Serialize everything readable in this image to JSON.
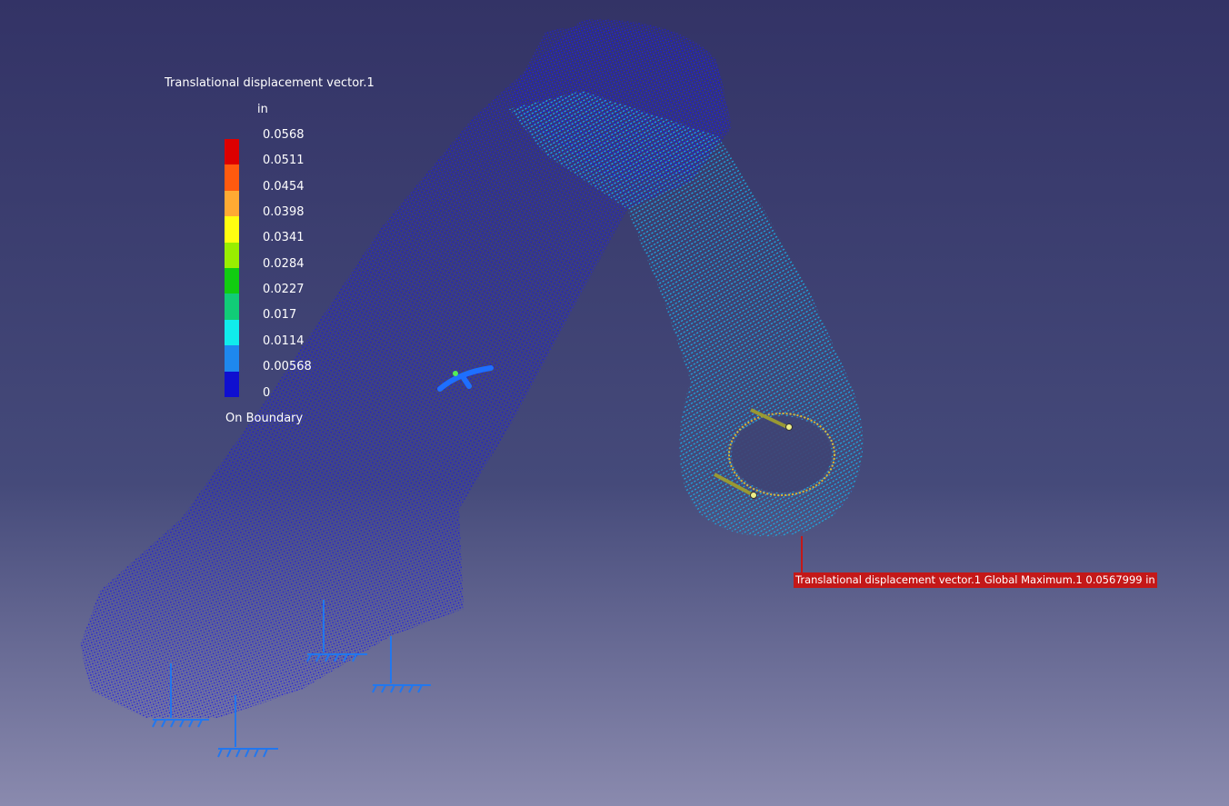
{
  "background": {
    "top_color": "#333366",
    "mid_color": "#454a7a",
    "bottom_color": "#8a8aae"
  },
  "legend": {
    "title": "Translational displacement vector.1",
    "unit": "in",
    "labels": [
      "0.0568",
      "0.0511",
      "0.0454",
      "0.0398",
      "0.0341",
      "0.0284",
      "0.0227",
      "0.017",
      "0.0114",
      "0.00568",
      "0"
    ],
    "colors": [
      "#dd0000",
      "#ff5a0f",
      "#ffaa33",
      "#ffff10",
      "#99ee00",
      "#11cc11",
      "#11cc77",
      "#10ecec",
      "#1e88ee",
      "#0f0fd0"
    ],
    "footer": "On Boundary"
  },
  "max_annotation": {
    "text": "Translational displacement vector.1  Global Maximum.1  0.0567999 in",
    "color": "#c41818"
  },
  "model": {
    "mesh_color": "#1a1ae0",
    "restraint_color": "#2277ee",
    "load_color": "#999933"
  }
}
